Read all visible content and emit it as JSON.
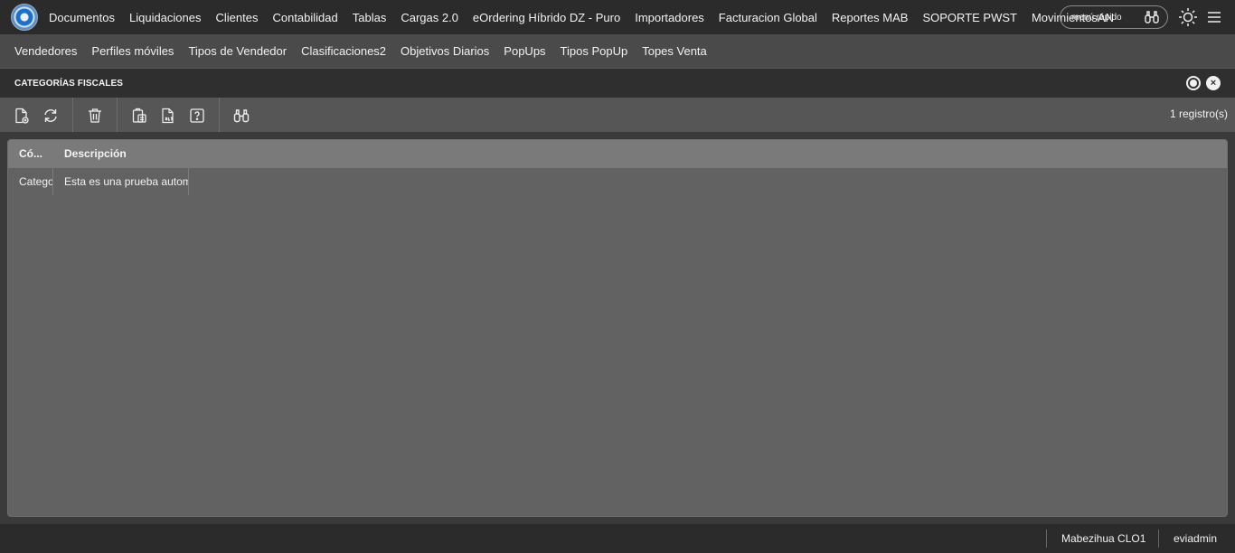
{
  "topbar": {
    "menu": [
      "Documentos",
      "Liquidaciones",
      "Clientes",
      "Contabilidad",
      "Tablas",
      "Cargas 2.0",
      "eOrdering Híbrido DZ - Puro",
      "Importadores",
      "Facturacion Global",
      "Reportes MAB",
      "SOPORTE PWST",
      "MovimientosAN"
    ],
    "quick_menu_label": "menú rápido"
  },
  "submenu": [
    "Vendedores",
    "Perfiles móviles",
    "Tipos de Vendedor",
    "Clasificaciones2",
    "Objetivos Diarios",
    "PopUps",
    "Tipos PopUp",
    "Topes Venta"
  ],
  "panel": {
    "title": "CATEGORÍAS FISCALES",
    "close_glyph": "×"
  },
  "toolbar": {
    "record_count": "1 registro(s)"
  },
  "grid": {
    "columns": [
      "Có...",
      "Descripción"
    ],
    "rows": [
      [
        "Catego",
        "Esta es una prueba automa"
      ]
    ]
  },
  "statusbar": {
    "company": "Mabezihua CLO1",
    "user": "eviadmin"
  }
}
